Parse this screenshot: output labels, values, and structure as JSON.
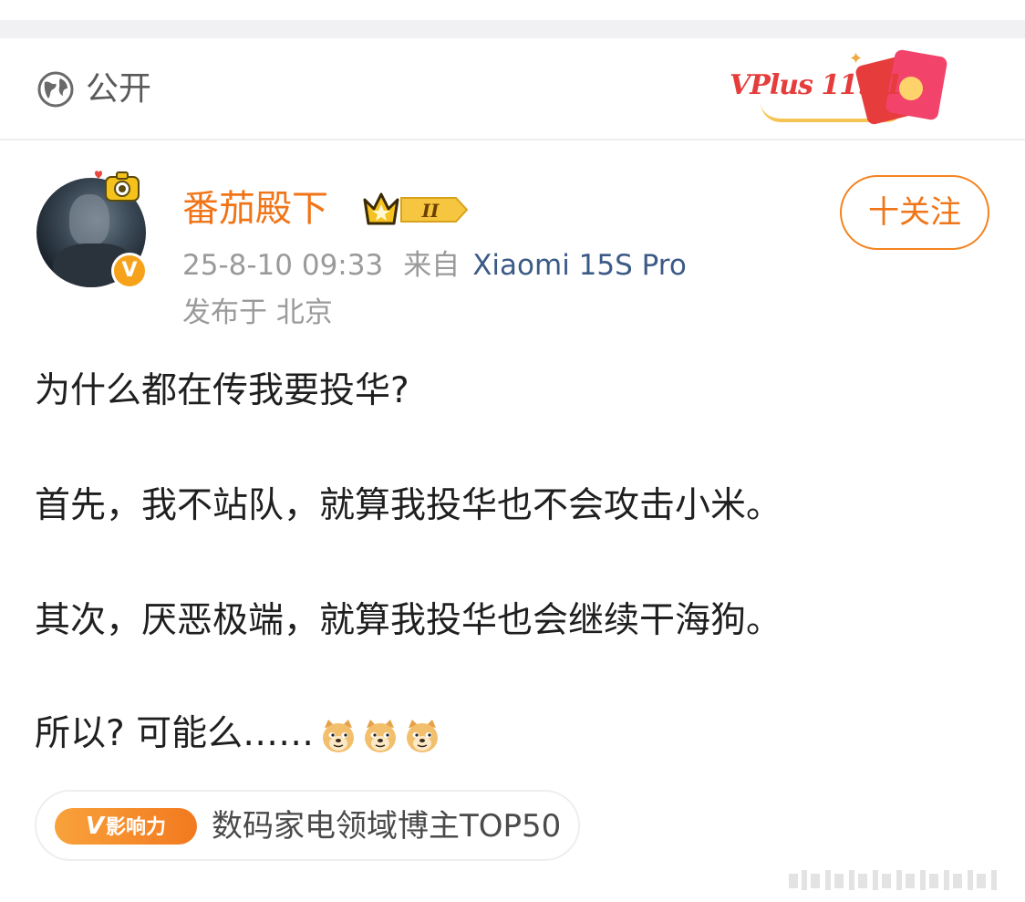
{
  "visibility": {
    "label": "公开",
    "icon": "globe-icon"
  },
  "promo": {
    "text": "VPlus 11.11"
  },
  "author": {
    "name": "番茄殿下",
    "vip_level": "II",
    "verified_mark": "V",
    "name_color": "#f07518"
  },
  "follow_button": {
    "label": "十关注"
  },
  "post_meta": {
    "time": "25-8-10 09:33",
    "source_prefix": "来自",
    "device": "Xiaomi 15S Pro",
    "location": "发布于 北京"
  },
  "post": {
    "lines": [
      "为什么都在传我要投华?",
      "首先，我不站队，就算我投华也不会攻击小米。",
      "其次，厌恶极端，就算我投华也会继续干海狗。",
      "所以? 可能么……"
    ],
    "emoji": "doge-emoji"
  },
  "influence": {
    "badge_v": "V",
    "badge_label": "影响力",
    "text": "数码家电领域博主TOP50"
  },
  "colors": {
    "accent": "#f07518",
    "device_link": "#3b5a86",
    "meta": "#9a9a9a"
  }
}
